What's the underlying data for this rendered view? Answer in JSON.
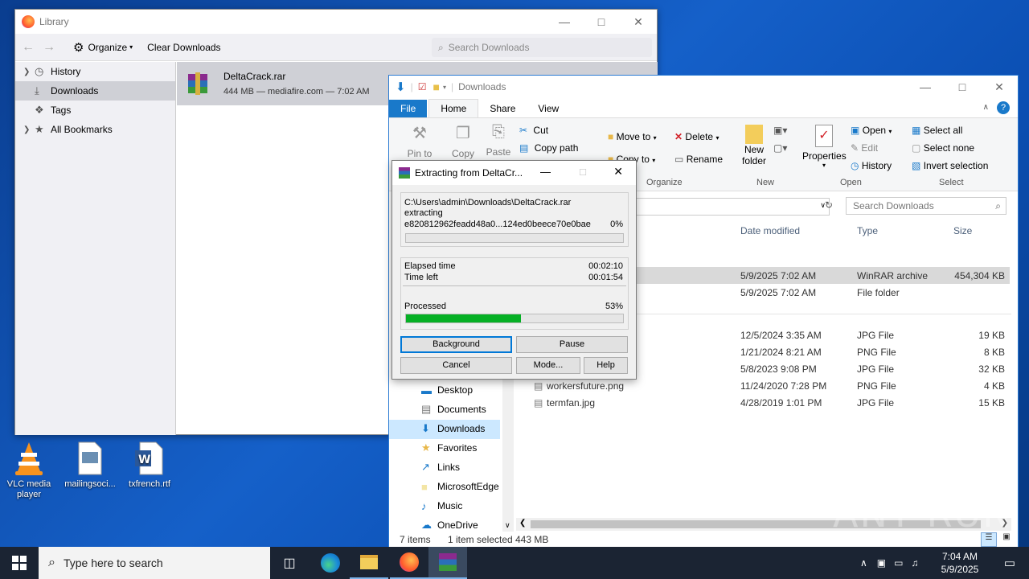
{
  "desktop": {
    "icons": [
      {
        "label": "VLC media player"
      },
      {
        "label": "mailingsoci..."
      },
      {
        "label": "txfrench.rtf"
      }
    ]
  },
  "library": {
    "title": "Library",
    "toolbar": {
      "organize": "Organize",
      "clear": "Clear Downloads",
      "search_placeholder": "Search Downloads"
    },
    "sidebar": [
      {
        "label": "History",
        "icon": "clock-icon",
        "selected": false,
        "expandable": true
      },
      {
        "label": "Downloads",
        "icon": "download-icon",
        "selected": true,
        "expandable": false
      },
      {
        "label": "Tags",
        "icon": "tag-icon",
        "selected": false,
        "expandable": false
      },
      {
        "label": "All Bookmarks",
        "icon": "star-icon",
        "selected": false,
        "expandable": true
      }
    ],
    "download": {
      "name": "DeltaCrack.rar",
      "meta": "444 MB — mediafire.com — 7:02 AM"
    }
  },
  "explorer": {
    "title": "Downloads",
    "tabs": [
      "File",
      "Home",
      "Share",
      "View"
    ],
    "ribbon": {
      "clipboard": {
        "pin": "Pin to Quick",
        "copy": "Copy",
        "paste": "Paste",
        "cut": "Cut",
        "copy_path": "Copy path"
      },
      "organize": {
        "label": "Organize",
        "move_to": "Move to",
        "copy_to": "Copy to",
        "delete": "Delete",
        "rename": "Rename"
      },
      "new": {
        "label": "New",
        "new_folder_1": "New",
        "new_folder_2": "folder"
      },
      "open": {
        "label": "Open",
        "properties": "Properties",
        "open": "Open",
        "edit": "Edit",
        "history": "History"
      },
      "select": {
        "label": "Select",
        "all": "Select all",
        "none": "Select none",
        "invert": "Invert selection"
      }
    },
    "search_placeholder": "Search Downloads",
    "columns": {
      "date": "Date modified",
      "type": "Type",
      "size": "Size"
    },
    "files": [
      {
        "name": "",
        "date": "5/9/2025 7:02 AM",
        "type": "WinRAR archive",
        "size": "454,304 KB",
        "selected": true
      },
      {
        "name": "",
        "date": "5/9/2025 7:02 AM",
        "type": "File folder",
        "size": "",
        "selected": false
      },
      {
        "name": "",
        "date": "12/5/2024 3:35 AM",
        "type": "JPG File",
        "size": "19 KB",
        "selected": false
      },
      {
        "name": "",
        "date": "1/21/2024 8:21 AM",
        "type": "PNG File",
        "size": "8 KB",
        "selected": false
      },
      {
        "name": "",
        "date": "5/8/2023 9:08 PM",
        "type": "JPG File",
        "size": "32 KB",
        "selected": false
      },
      {
        "name": "workersfuture.png",
        "date": "11/24/2020 7:28 PM",
        "type": "PNG File",
        "size": "4 KB",
        "selected": false
      },
      {
        "name": "termfan.jpg",
        "date": "4/28/2019 1:01 PM",
        "type": "JPG File",
        "size": "15 KB",
        "selected": false
      }
    ],
    "tree": [
      "Desktop",
      "Documents",
      "Downloads",
      "Favorites",
      "Links",
      "MicrosoftEdge",
      "Music",
      "OneDrive"
    ],
    "tree_selected": "Downloads",
    "status": {
      "items": "7 items",
      "selected": "1 item selected",
      "size": "443 MB"
    }
  },
  "extract": {
    "title": "Extracting from DeltaCr...",
    "path": "C:\\Users\\admin\\Downloads\\DeltaCrack.rar",
    "action": "extracting",
    "file": "e820812962feadd48a0...124ed0beece70e0bae",
    "file_percent": "0%",
    "file_progress": 0,
    "elapsed_label": "Elapsed time",
    "elapsed": "00:02:10",
    "left_label": "Time left",
    "left": "00:01:54",
    "processed_label": "Processed",
    "processed_percent": "53%",
    "processed_progress": 0.53,
    "buttons": {
      "background": "Background",
      "pause": "Pause",
      "cancel": "Cancel",
      "mode": "Mode...",
      "help": "Help"
    }
  },
  "taskbar": {
    "search_placeholder": "Type here to search",
    "time": "7:04 AM",
    "date": "5/9/2025"
  },
  "watermark": "ANY RUN"
}
